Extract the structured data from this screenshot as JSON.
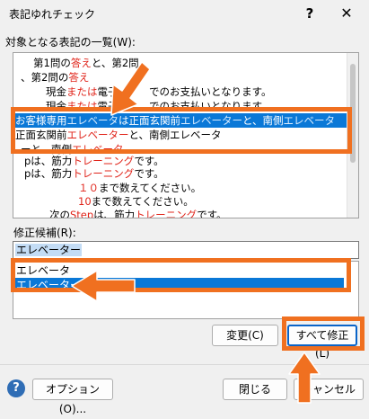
{
  "window": {
    "title": "表記ゆれチェック",
    "help_glyph": "?",
    "close_glyph": "✕"
  },
  "targets": {
    "label": "対象となる表記の一覧(W):",
    "lines": [
      "第1問の",
      "答え",
      "と、第2問",
      "、第2問の",
      "答え",
      "現金",
      "または",
      "電子",
      "でのお支払いとなります。",
      "現金",
      "または",
      "電子",
      "でのお支払いとなります。",
      "お客様専用",
      "エレベータ",
      "は正面玄関前",
      "エレベーター",
      "と、南側",
      "エレベータ",
      "正面玄関前",
      "エレベーター",
      "と、南側エレベータ",
      "ーと、南側",
      "エレベータ",
      "pは、筋力",
      "トレーニング",
      "です。",
      "pは、筋力",
      "トレーニング",
      "です。",
      "１０",
      "まで数えてください。",
      "10",
      "まで数えてください。",
      "次の",
      "Step",
      "は、筋力",
      "トレーニング",
      "です。"
    ]
  },
  "candidates": {
    "label": "修正候補(R):",
    "input_value": "エレベーター",
    "items": [
      "エレベータ",
      "エレベーター"
    ]
  },
  "buttons": {
    "change": "変更(C)",
    "fix_all": "すべて修正(L)",
    "options": "オプション(O)...",
    "close": "閉じる",
    "cancel": "キャンセル"
  },
  "colors": {
    "highlight_red": "#e0241a",
    "selection_blue": "#0a78d7",
    "annotation_orange": "#f07020"
  }
}
